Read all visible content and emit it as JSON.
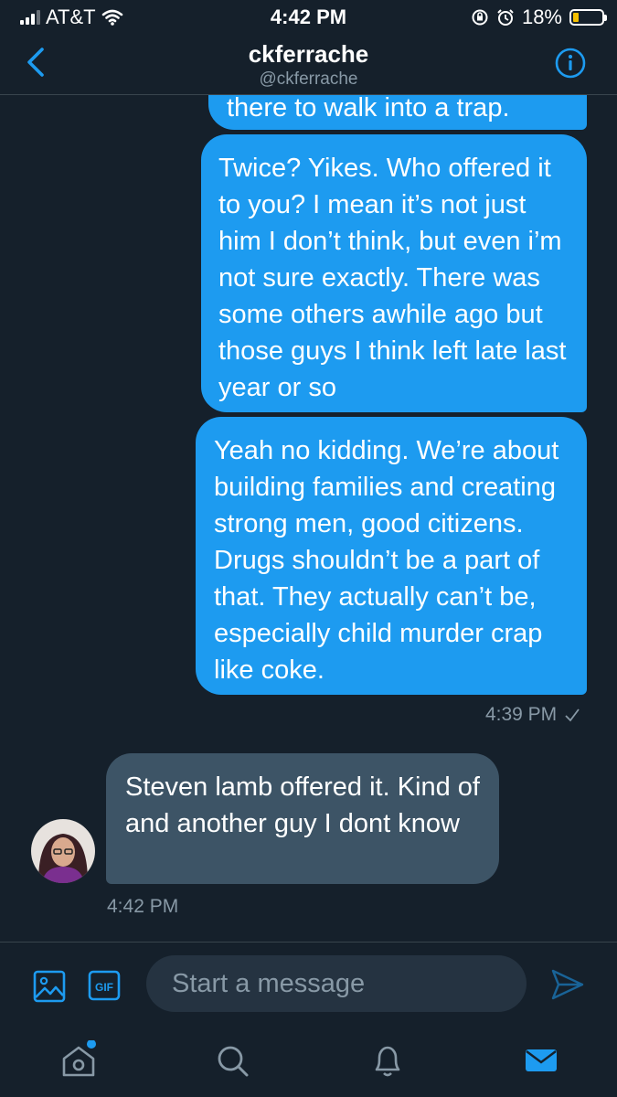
{
  "status_bar": {
    "carrier": "AT&T",
    "time": "4:42 PM",
    "battery_percent": "18%"
  },
  "header": {
    "title": "ckferrache",
    "handle": "@ckferrache"
  },
  "messages": [
    {
      "type": "sent",
      "text": "there to walk into a trap."
    },
    {
      "type": "sent",
      "text": "Twice? Yikes. Who offered it to you? I mean it’s not just him I don’t think, but even i’m not sure exactly. There was some others awhile ago but those guys I think left late last year or so"
    },
    {
      "type": "sent",
      "text": "Yeah no kidding. We’re about building families and creating strong men, good citizens. Drugs shouldn’t be a part of that. They actually can’t be, especially child murder crap like coke."
    },
    {
      "type": "received",
      "text": "Steven lamb offered it. Kind of and another guy I dont know"
    }
  ],
  "sent_timestamp": "4:39 PM",
  "read_receipt_icon": "checkmark-icon",
  "received_timestamp": "4:42 PM",
  "composer": {
    "placeholder": "Start a message",
    "gif_label": "GIF"
  },
  "tabs": [
    "home-icon",
    "search-icon",
    "notifications-icon",
    "messages-icon"
  ],
  "colors": {
    "accent": "#1d9bf0",
    "background": "#15202b",
    "received_bubble": "#3d5466",
    "secondary_text": "#8899a6"
  }
}
